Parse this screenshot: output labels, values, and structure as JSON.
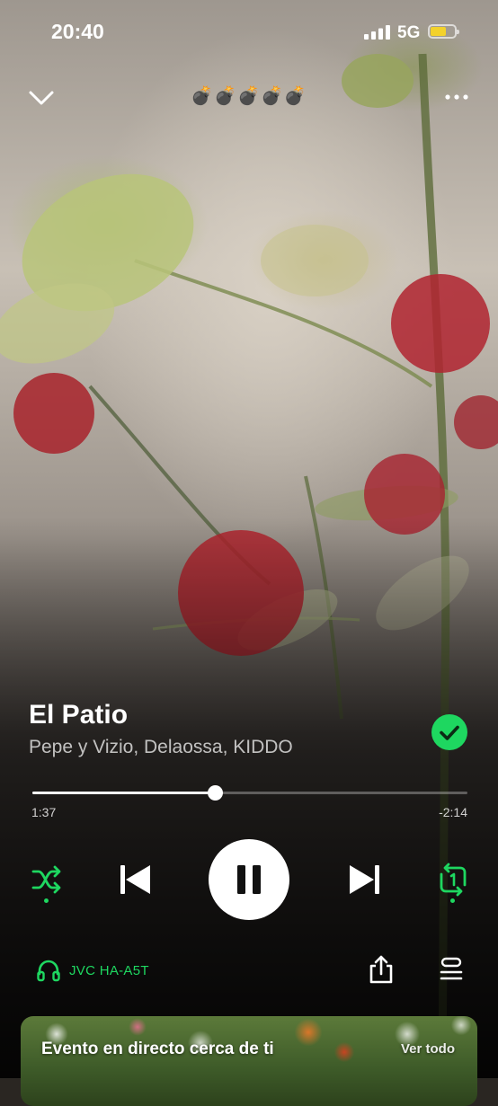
{
  "status_bar": {
    "time": "20:40",
    "network": "5G"
  },
  "header": {
    "context_title": "💣💣💣💣💣"
  },
  "track": {
    "title": "El Patio",
    "artists": "Pepe y Vizio, Delaossa, KIDDO",
    "liked": true
  },
  "playback": {
    "elapsed": "1:37",
    "remaining": "-2:14",
    "progress_fraction": 0.42,
    "shuffle_active": true,
    "repeat_mode": "repeat-one",
    "is_playing": true
  },
  "device": {
    "name": "JVC HA-A5T"
  },
  "event_card": {
    "title": "Evento en directo cerca de ti",
    "see_all": "Ver todo"
  },
  "colors": {
    "accent": "#1ed760",
    "battery": "#f3d22b"
  }
}
